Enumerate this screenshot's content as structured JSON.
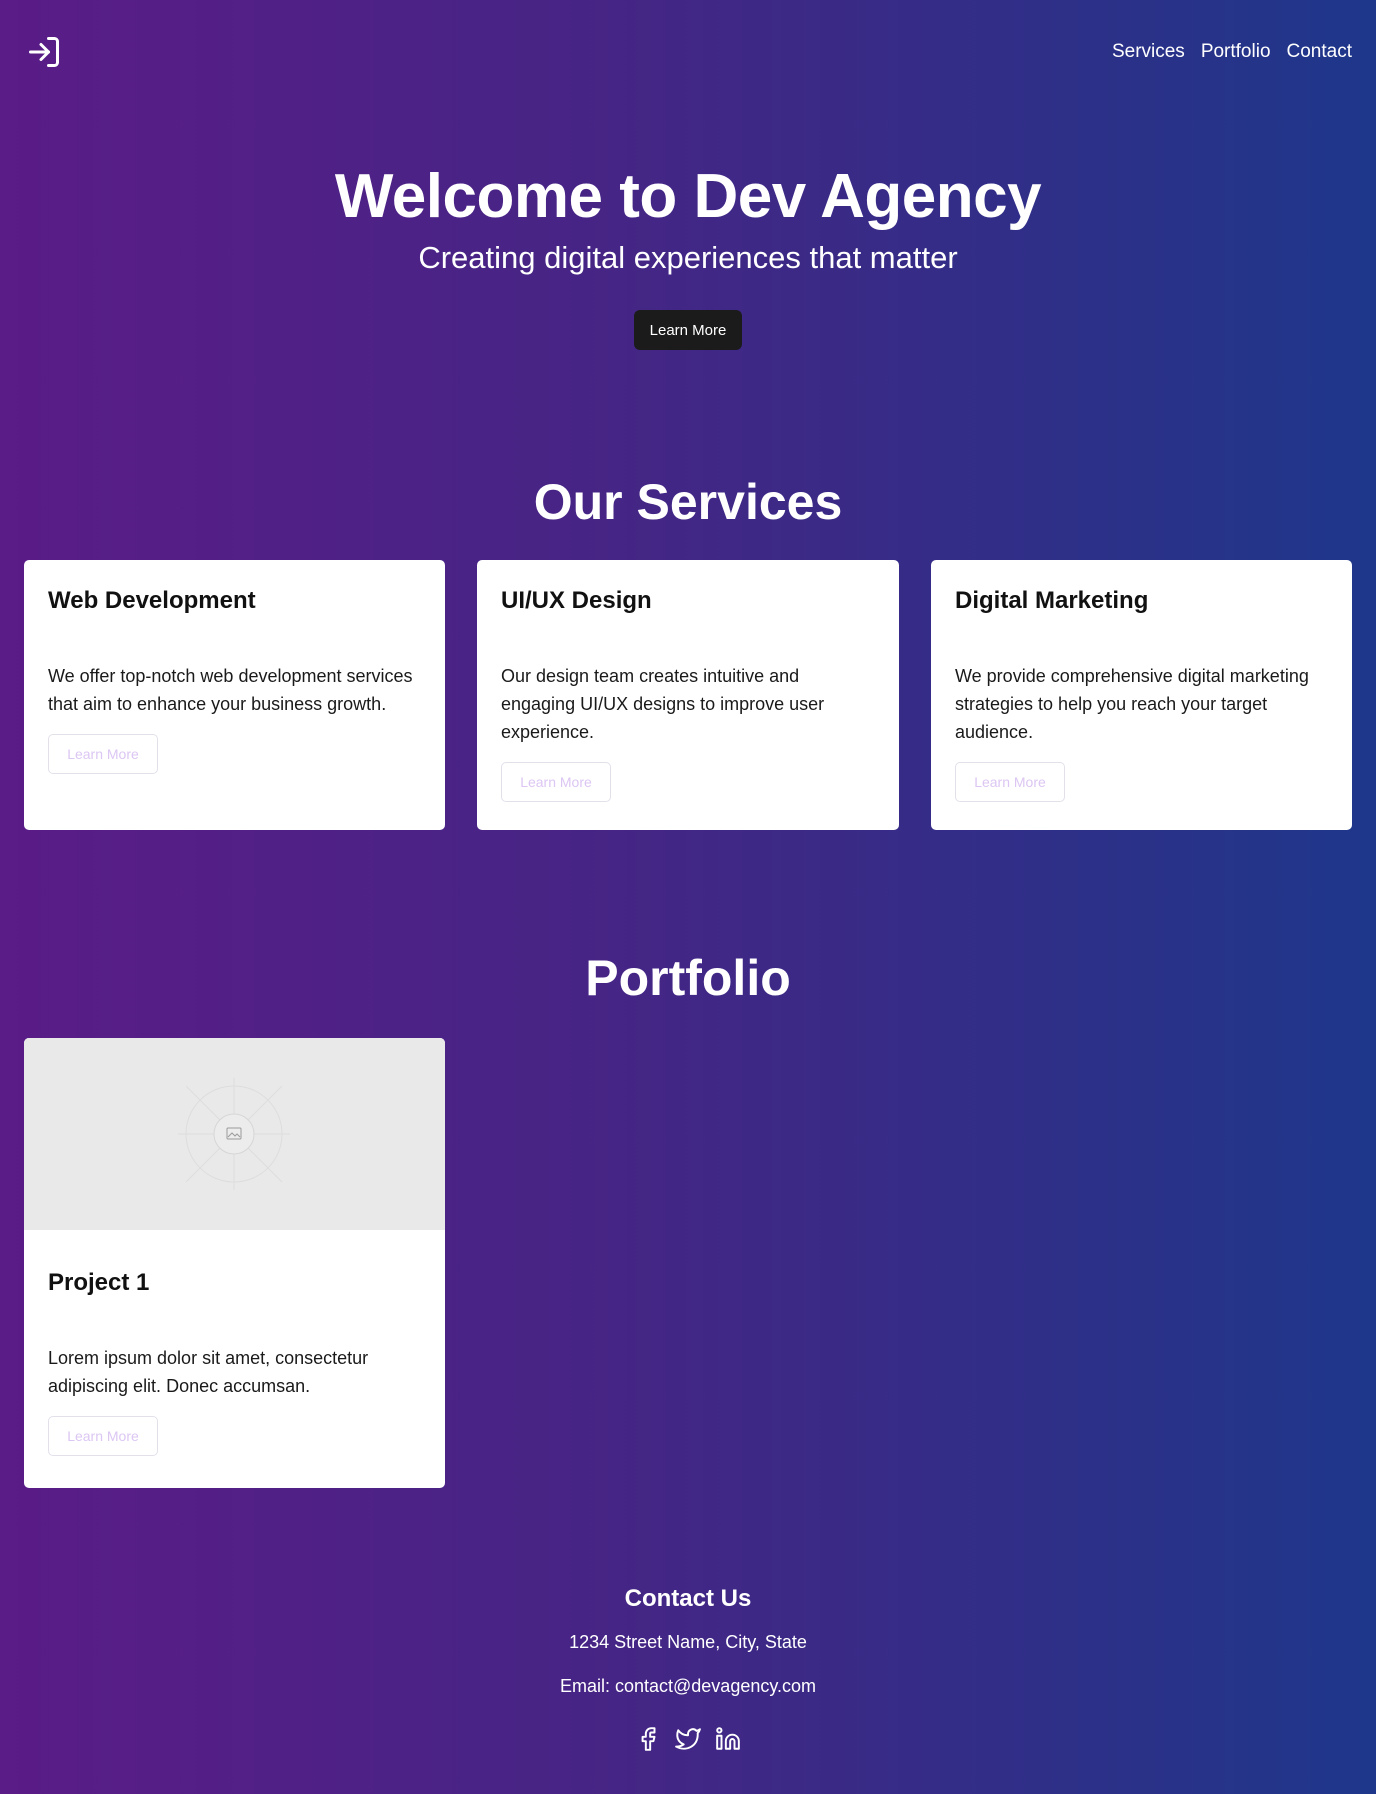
{
  "nav": {
    "items": [
      {
        "label": "Services"
      },
      {
        "label": "Portfolio"
      },
      {
        "label": "Contact"
      }
    ]
  },
  "hero": {
    "title": "Welcome to Dev Agency",
    "subtitle": "Creating digital experiences that matter",
    "cta_label": "Learn More"
  },
  "services": {
    "title": "Our Services",
    "cards": [
      {
        "title": "Web Development",
        "text": "We offer top-notch web development services that aim to enhance your business growth.",
        "button": "Learn More"
      },
      {
        "title": "UI/UX Design",
        "text": "Our design team creates intuitive and engaging UI/UX designs to improve user experience.",
        "button": "Learn More"
      },
      {
        "title": "Digital Marketing",
        "text": "We provide comprehensive digital marketing strategies to help you reach your target audience.",
        "button": "Learn More"
      }
    ]
  },
  "portfolio": {
    "title": "Portfolio",
    "cards": [
      {
        "title": "Project 1",
        "text": "Lorem ipsum dolor sit amet, consectetur adipiscing elit. Donec accumsan.",
        "button": "Learn More"
      }
    ]
  },
  "contact": {
    "title": "Contact Us",
    "address": "1234 Street Name, City, State",
    "email": "Email: contact@devagency.com"
  },
  "icons": {
    "logo": "login-arrow-icon",
    "social": [
      "facebook-icon",
      "twitter-icon",
      "linkedin-icon"
    ],
    "image_placeholder": "image-placeholder-icon"
  },
  "colors": {
    "gradient_start": "#5a1c87",
    "gradient_end": "#1e378a",
    "button_dark": "#1b1b1b",
    "outline_button_text": "#dcc6f3"
  }
}
